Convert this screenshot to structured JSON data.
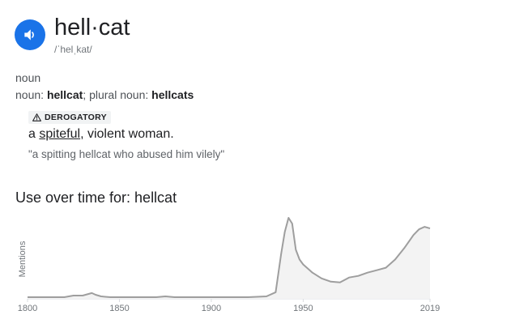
{
  "entry": {
    "headword": "hell·cat",
    "phonetic": "/ˈhelˌkat/",
    "part_of_speech": "noun",
    "forms": {
      "noun_label": "noun",
      "noun_value": "hellcat",
      "plural_label": "plural noun",
      "plural_value": "hellcats"
    },
    "usage_label": "DEROGATORY",
    "definition": {
      "prefix": "a",
      "link_word": "spiteful",
      "suffix": ", violent woman."
    },
    "example": "\"a spitting hellcat who abused him vilely\""
  },
  "icons": {
    "speaker": "speaker-icon",
    "warning": "warning-icon"
  },
  "colors": {
    "accent": "#1a73e8",
    "line": "#9e9e9e",
    "area": "#f3f3f3"
  },
  "chart": {
    "heading": "Use over time for: hellcat"
  },
  "chart_data": {
    "type": "area",
    "title": "Use over time for: hellcat",
    "ylabel": "Mentions",
    "xlabel": "",
    "xlim": [
      1800,
      2019
    ],
    "ylim": [
      0,
      100
    ],
    "x_ticks": [
      1800,
      1850,
      1900,
      1950,
      2019
    ],
    "x": [
      1790,
      1800,
      1810,
      1820,
      1825,
      1830,
      1835,
      1837,
      1840,
      1845,
      1850,
      1860,
      1870,
      1875,
      1880,
      1890,
      1900,
      1910,
      1920,
      1930,
      1935,
      1938,
      1940,
      1942,
      1944,
      1946,
      1948,
      1950,
      1955,
      1960,
      1965,
      1970,
      1975,
      1980,
      1985,
      1990,
      1995,
      2000,
      2005,
      2010,
      2013,
      2016,
      2019
    ],
    "y": [
      2,
      2,
      2,
      2,
      4,
      4,
      7,
      5,
      3,
      2,
      2,
      2,
      2,
      3,
      2,
      2,
      2,
      2,
      2,
      3,
      8,
      55,
      82,
      99,
      92,
      60,
      48,
      42,
      32,
      25,
      21,
      20,
      26,
      28,
      32,
      35,
      38,
      48,
      62,
      78,
      85,
      88,
      86
    ]
  }
}
